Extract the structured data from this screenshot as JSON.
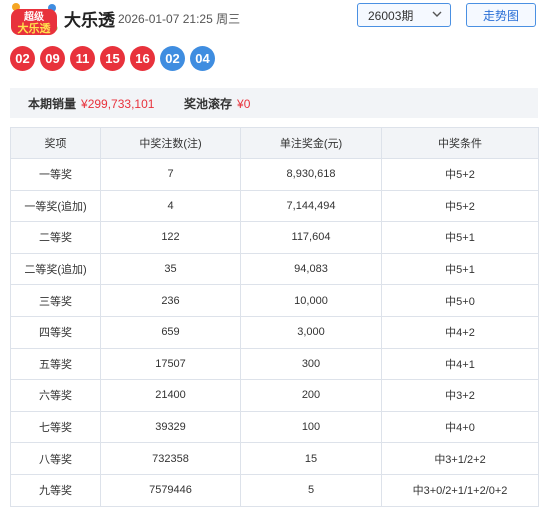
{
  "header": {
    "logo_text_line1": "超级",
    "logo_text_line2": "大乐透",
    "title": "大乐透",
    "draw_date": "2026-01-07 21:25 周三",
    "period_selected": "26003期",
    "trend_button": "走势图"
  },
  "numbers": {
    "red": [
      "02",
      "09",
      "11",
      "15",
      "16"
    ],
    "blue": [
      "02",
      "04"
    ]
  },
  "summary": {
    "sales_label": "本期销量",
    "sales_value": "¥299,733,101",
    "pool_label": "奖池滚存",
    "pool_value": "¥0"
  },
  "table": {
    "headers": [
      "奖项",
      "中奖注数(注)",
      "单注奖金(元)",
      "中奖条件"
    ],
    "rows": [
      [
        "一等奖",
        "7",
        "8,930,618",
        "中5+2"
      ],
      [
        "一等奖(追加)",
        "4",
        "7,144,494",
        "中5+2"
      ],
      [
        "二等奖",
        "122",
        "117,604",
        "中5+1"
      ],
      [
        "二等奖(追加)",
        "35",
        "94,083",
        "中5+1"
      ],
      [
        "三等奖",
        "236",
        "10,000",
        "中5+0"
      ],
      [
        "四等奖",
        "659",
        "3,000",
        "中4+2"
      ],
      [
        "五等奖",
        "17507",
        "300",
        "中4+1"
      ],
      [
        "六等奖",
        "21400",
        "200",
        "中3+2"
      ],
      [
        "七等奖",
        "39329",
        "100",
        "中4+0"
      ],
      [
        "八等奖",
        "732358",
        "15",
        "中3+1/2+2"
      ],
      [
        "九等奖",
        "7579446",
        "5",
        "中3+0/2+1/1+2/0+2"
      ]
    ]
  },
  "colors": {
    "red_ball": "#e8323c",
    "blue_ball": "#3f8de0",
    "accent": "#4a90e2"
  }
}
